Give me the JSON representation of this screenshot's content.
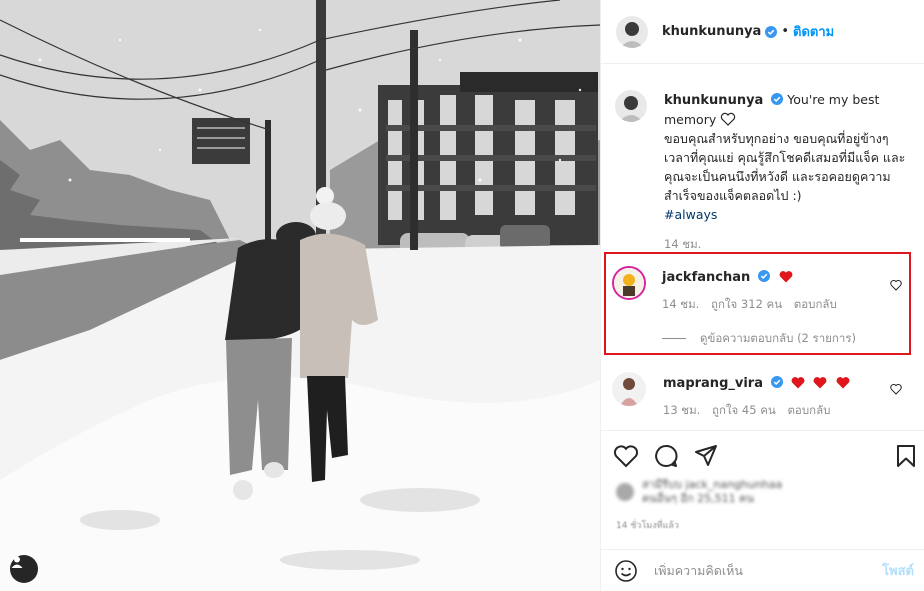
{
  "post": {
    "username": "khunkununya",
    "follow_label": "ติดตาม",
    "separator": "•"
  },
  "caption": {
    "username": "khunkununya",
    "first_line": "You're my best memory",
    "text": "ขอบคุณสำหรับทุกอย่าง ขอบคุณที่อยู่ข้างๆเวลาที่คุณแย่ คุณรู้สึกโชคดีเสมอที่มีแจ็ค และคุณจะเป็นคนนึงที่หวังดี และรอคอยดูความสำเร็จของแจ็คตลอดไป :)",
    "hashtag": "#always",
    "time": "14 ชม."
  },
  "comments": [
    {
      "username": "jackfanchan",
      "time": "14 ชม.",
      "likes": "ถูกใจ 312 คน",
      "reply_label": "ตอบกลับ",
      "view_replies": "ดูข้อความตอบกลับ (2 รายการ)",
      "hearts": 1
    },
    {
      "username": "maprang_vira",
      "time": "13 ชม.",
      "likes": "ถูกใจ 45 คน",
      "reply_label": "ตอบกลับ",
      "hearts": 3
    }
  ],
  "liked_by": {
    "line1": "สามีรีบบ jack_nanghunhaa",
    "line2": "คนอื่นๆ อีก 25,511 คน"
  },
  "time_ago": "14 ชั่วโมงที่แล้ว",
  "add_comment": {
    "placeholder": "เพิ่มความคิดเห็น",
    "post_label": "โพสต์"
  },
  "icons": {
    "verified": "verified-badge-icon",
    "like": "heart-outline-icon",
    "comment": "comment-bubble-icon",
    "share": "paper-plane-icon",
    "save": "bookmark-icon",
    "emoji": "smiley-icon",
    "user_tag": "person-icon"
  },
  "colors": {
    "accent_blue": "#0095f6",
    "verified_blue": "#3897f0",
    "heart_red": "#ed4956",
    "highlight_red": "#e0161d",
    "link_dark": "#00376b"
  }
}
